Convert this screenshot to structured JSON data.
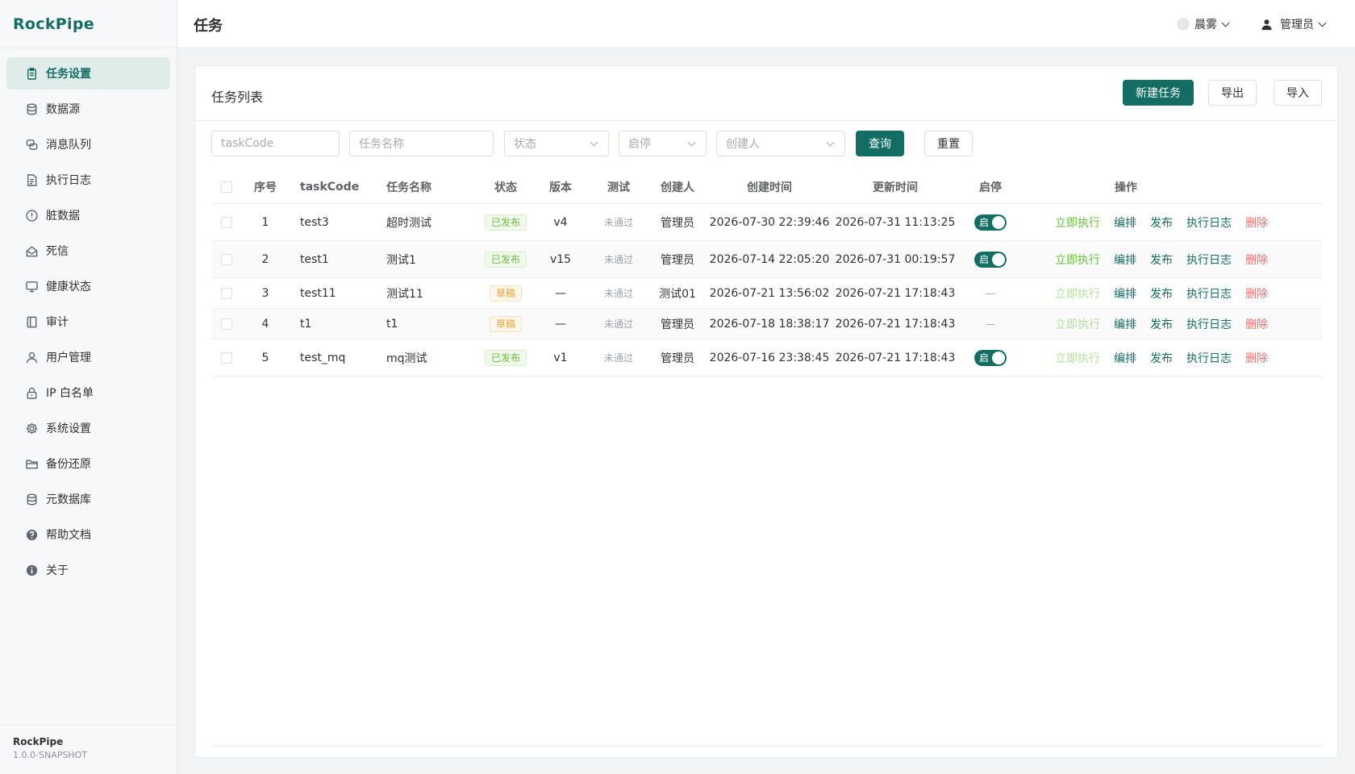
{
  "app": {
    "name": "RockPipe",
    "version": "1.0.0-SNAPSHOT"
  },
  "sidebar": {
    "items": [
      {
        "label": "任务设置",
        "icon": "clipboard-icon",
        "active": true
      },
      {
        "label": "数据源",
        "icon": "database-icon"
      },
      {
        "label": "消息队列",
        "icon": "queue-icon"
      },
      {
        "label": "执行日志",
        "icon": "file-log-icon"
      },
      {
        "label": "脏数据",
        "icon": "alert-circle-icon"
      },
      {
        "label": "死信",
        "icon": "mail-icon"
      },
      {
        "label": "健康状态",
        "icon": "monitor-icon"
      },
      {
        "label": "审计",
        "icon": "audit-icon"
      },
      {
        "label": "用户管理",
        "icon": "user-icon"
      },
      {
        "label": "IP 白名单",
        "icon": "lock-icon"
      },
      {
        "label": "系统设置",
        "icon": "gear-icon"
      },
      {
        "label": "备份还原",
        "icon": "folder-icon"
      },
      {
        "label": "元数据库",
        "icon": "database-stack-icon"
      },
      {
        "label": "帮助文档",
        "icon": "help-icon"
      },
      {
        "label": "关于",
        "icon": "info-icon"
      }
    ]
  },
  "header": {
    "title": "任务",
    "theme": "晨雾",
    "user": "管理员"
  },
  "card": {
    "title": "任务列表",
    "new_button": "新建任务",
    "export_button": "导出",
    "import_button": "导入"
  },
  "filters": {
    "task_code_placeholder": "taskCode",
    "task_name_placeholder": "任务名称",
    "status_placeholder": "状态",
    "enabled_placeholder": "启停",
    "creator_placeholder": "创建人",
    "query_button": "查询",
    "reset_button": "重置"
  },
  "table": {
    "headers": {
      "index": "序号",
      "task_code": "taskCode",
      "task_name": "任务名称",
      "status": "状态",
      "version": "版本",
      "test": "测试",
      "creator": "创建人",
      "created_at": "创建时间",
      "updated_at": "更新时间",
      "enabled": "启停",
      "actions": "操作"
    },
    "actions": {
      "run": "立即执行",
      "edit": "编排",
      "publish": "发布",
      "logs": "执行日志",
      "delete": "删除"
    },
    "toggle_label": "启",
    "rows": [
      {
        "index": "1",
        "task_code": "test3",
        "task_name": "超时测试",
        "status": "已发布",
        "status_color": "#67c23a",
        "version": "v4",
        "test": "未通过",
        "creator": "管理员",
        "created_at": "2026-07-30 22:39:46",
        "updated_at": "2026-07-31 11:13:25",
        "enabled": "on",
        "run_disabled": false
      },
      {
        "index": "2",
        "task_code": "test1",
        "task_name": "测试1",
        "status": "已发布",
        "status_color": "#67c23a",
        "version": "v15",
        "test": "未通过",
        "creator": "管理员",
        "created_at": "2026-07-14 22:05:20",
        "updated_at": "2026-07-31 00:19:57",
        "enabled": "on",
        "run_disabled": false
      },
      {
        "index": "3",
        "task_code": "test11",
        "task_name": "测试11",
        "status": "草稿",
        "status_color": "#e6a23c",
        "version": "—",
        "test": "未通过",
        "creator": "测试01",
        "created_at": "2026-07-21 13:56:02",
        "updated_at": "2026-07-21 17:18:43",
        "enabled": "—",
        "run_disabled": true
      },
      {
        "index": "4",
        "task_code": "t1",
        "task_name": "t1",
        "status": "草稿",
        "status_color": "#e6a23c",
        "version": "—",
        "test": "未通过",
        "creator": "管理员",
        "created_at": "2026-07-18 18:38:17",
        "updated_at": "2026-07-21 17:18:43",
        "enabled": "—",
        "run_disabled": true
      },
      {
        "index": "5",
        "task_code": "test_mq",
        "task_name": "mq测试",
        "status": "已发布",
        "status_color": "#67c23a",
        "version": "v1",
        "test": "未通过",
        "creator": "管理员",
        "created_at": "2026-07-16 23:38:45",
        "updated_at": "2026-07-21 17:18:43",
        "enabled": "on",
        "run_disabled": true
      }
    ]
  },
  "colors": {
    "brand": "#136d62",
    "success": "#67c23a",
    "warning": "#e6a23c",
    "danger": "#f56c6c"
  }
}
